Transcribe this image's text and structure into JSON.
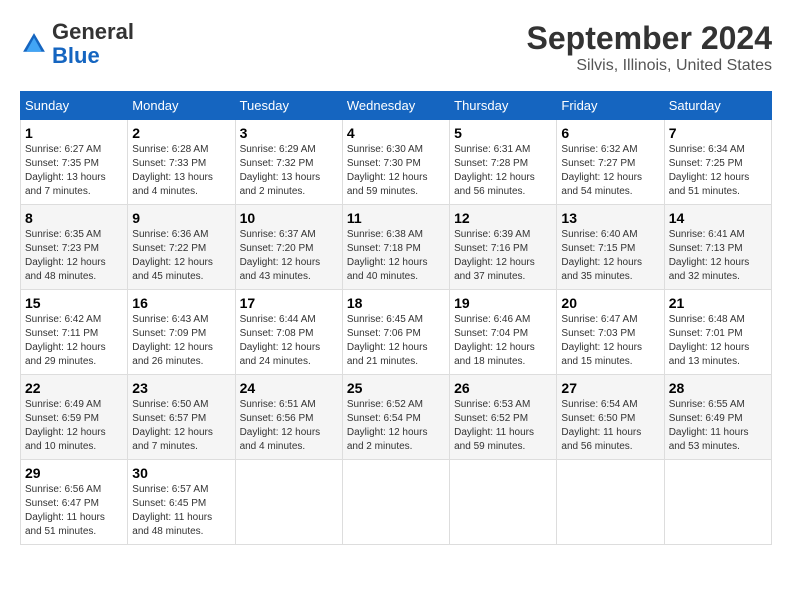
{
  "logo": {
    "general": "General",
    "blue": "Blue"
  },
  "title": "September 2024",
  "subtitle": "Silvis, Illinois, United States",
  "days_of_week": [
    "Sunday",
    "Monday",
    "Tuesday",
    "Wednesday",
    "Thursday",
    "Friday",
    "Saturday"
  ],
  "weeks": [
    [
      {
        "day": "1",
        "sunrise": "Sunrise: 6:27 AM",
        "sunset": "Sunset: 7:35 PM",
        "daylight": "Daylight: 13 hours and 7 minutes."
      },
      {
        "day": "2",
        "sunrise": "Sunrise: 6:28 AM",
        "sunset": "Sunset: 7:33 PM",
        "daylight": "Daylight: 13 hours and 4 minutes."
      },
      {
        "day": "3",
        "sunrise": "Sunrise: 6:29 AM",
        "sunset": "Sunset: 7:32 PM",
        "daylight": "Daylight: 13 hours and 2 minutes."
      },
      {
        "day": "4",
        "sunrise": "Sunrise: 6:30 AM",
        "sunset": "Sunset: 7:30 PM",
        "daylight": "Daylight: 12 hours and 59 minutes."
      },
      {
        "day": "5",
        "sunrise": "Sunrise: 6:31 AM",
        "sunset": "Sunset: 7:28 PM",
        "daylight": "Daylight: 12 hours and 56 minutes."
      },
      {
        "day": "6",
        "sunrise": "Sunrise: 6:32 AM",
        "sunset": "Sunset: 7:27 PM",
        "daylight": "Daylight: 12 hours and 54 minutes."
      },
      {
        "day": "7",
        "sunrise": "Sunrise: 6:34 AM",
        "sunset": "Sunset: 7:25 PM",
        "daylight": "Daylight: 12 hours and 51 minutes."
      }
    ],
    [
      {
        "day": "8",
        "sunrise": "Sunrise: 6:35 AM",
        "sunset": "Sunset: 7:23 PM",
        "daylight": "Daylight: 12 hours and 48 minutes."
      },
      {
        "day": "9",
        "sunrise": "Sunrise: 6:36 AM",
        "sunset": "Sunset: 7:22 PM",
        "daylight": "Daylight: 12 hours and 45 minutes."
      },
      {
        "day": "10",
        "sunrise": "Sunrise: 6:37 AM",
        "sunset": "Sunset: 7:20 PM",
        "daylight": "Daylight: 12 hours and 43 minutes."
      },
      {
        "day": "11",
        "sunrise": "Sunrise: 6:38 AM",
        "sunset": "Sunset: 7:18 PM",
        "daylight": "Daylight: 12 hours and 40 minutes."
      },
      {
        "day": "12",
        "sunrise": "Sunrise: 6:39 AM",
        "sunset": "Sunset: 7:16 PM",
        "daylight": "Daylight: 12 hours and 37 minutes."
      },
      {
        "day": "13",
        "sunrise": "Sunrise: 6:40 AM",
        "sunset": "Sunset: 7:15 PM",
        "daylight": "Daylight: 12 hours and 35 minutes."
      },
      {
        "day": "14",
        "sunrise": "Sunrise: 6:41 AM",
        "sunset": "Sunset: 7:13 PM",
        "daylight": "Daylight: 12 hours and 32 minutes."
      }
    ],
    [
      {
        "day": "15",
        "sunrise": "Sunrise: 6:42 AM",
        "sunset": "Sunset: 7:11 PM",
        "daylight": "Daylight: 12 hours and 29 minutes."
      },
      {
        "day": "16",
        "sunrise": "Sunrise: 6:43 AM",
        "sunset": "Sunset: 7:09 PM",
        "daylight": "Daylight: 12 hours and 26 minutes."
      },
      {
        "day": "17",
        "sunrise": "Sunrise: 6:44 AM",
        "sunset": "Sunset: 7:08 PM",
        "daylight": "Daylight: 12 hours and 24 minutes."
      },
      {
        "day": "18",
        "sunrise": "Sunrise: 6:45 AM",
        "sunset": "Sunset: 7:06 PM",
        "daylight": "Daylight: 12 hours and 21 minutes."
      },
      {
        "day": "19",
        "sunrise": "Sunrise: 6:46 AM",
        "sunset": "Sunset: 7:04 PM",
        "daylight": "Daylight: 12 hours and 18 minutes."
      },
      {
        "day": "20",
        "sunrise": "Sunrise: 6:47 AM",
        "sunset": "Sunset: 7:03 PM",
        "daylight": "Daylight: 12 hours and 15 minutes."
      },
      {
        "day": "21",
        "sunrise": "Sunrise: 6:48 AM",
        "sunset": "Sunset: 7:01 PM",
        "daylight": "Daylight: 12 hours and 13 minutes."
      }
    ],
    [
      {
        "day": "22",
        "sunrise": "Sunrise: 6:49 AM",
        "sunset": "Sunset: 6:59 PM",
        "daylight": "Daylight: 12 hours and 10 minutes."
      },
      {
        "day": "23",
        "sunrise": "Sunrise: 6:50 AM",
        "sunset": "Sunset: 6:57 PM",
        "daylight": "Daylight: 12 hours and 7 minutes."
      },
      {
        "day": "24",
        "sunrise": "Sunrise: 6:51 AM",
        "sunset": "Sunset: 6:56 PM",
        "daylight": "Daylight: 12 hours and 4 minutes."
      },
      {
        "day": "25",
        "sunrise": "Sunrise: 6:52 AM",
        "sunset": "Sunset: 6:54 PM",
        "daylight": "Daylight: 12 hours and 2 minutes."
      },
      {
        "day": "26",
        "sunrise": "Sunrise: 6:53 AM",
        "sunset": "Sunset: 6:52 PM",
        "daylight": "Daylight: 11 hours and 59 minutes."
      },
      {
        "day": "27",
        "sunrise": "Sunrise: 6:54 AM",
        "sunset": "Sunset: 6:50 PM",
        "daylight": "Daylight: 11 hours and 56 minutes."
      },
      {
        "day": "28",
        "sunrise": "Sunrise: 6:55 AM",
        "sunset": "Sunset: 6:49 PM",
        "daylight": "Daylight: 11 hours and 53 minutes."
      }
    ],
    [
      {
        "day": "29",
        "sunrise": "Sunrise: 6:56 AM",
        "sunset": "Sunset: 6:47 PM",
        "daylight": "Daylight: 11 hours and 51 minutes."
      },
      {
        "day": "30",
        "sunrise": "Sunrise: 6:57 AM",
        "sunset": "Sunset: 6:45 PM",
        "daylight": "Daylight: 11 hours and 48 minutes."
      },
      null,
      null,
      null,
      null,
      null
    ]
  ]
}
